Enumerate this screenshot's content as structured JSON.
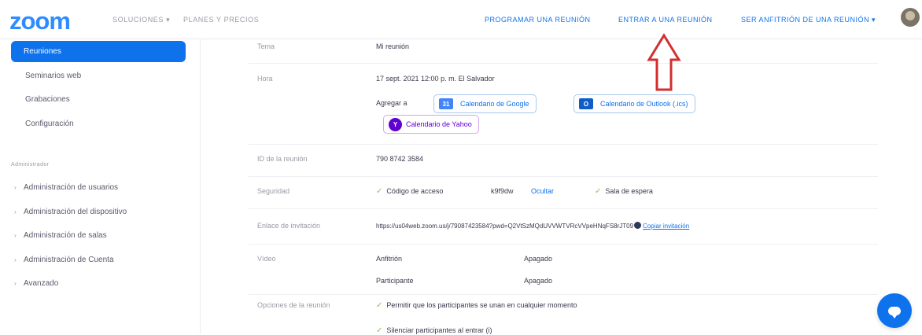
{
  "brand": {
    "logo_text": "zoom",
    "color": "#2d8cff",
    "accent": "#0e72ed"
  },
  "topnav": {
    "left": [
      {
        "label": "SOLUCIONES ▾"
      },
      {
        "label": "PLANES Y PRECIOS"
      }
    ],
    "right": [
      {
        "label": "PROGRAMAR UNA REUNIÓN"
      },
      {
        "label": "ENTRAR A UNA REUNIÓN"
      },
      {
        "label": "SER ANFITRIÓN DE UNA REUNIÓN ▾"
      }
    ],
    "avatar_icon": "user-avatar"
  },
  "sidebar": {
    "active_item": "Reuniones",
    "items": [
      "Seminarios web",
      "Grabaciones",
      "Configuración"
    ],
    "section_title": "Administrador",
    "admin_items": [
      "Administración de usuarios",
      "Administración del dispositivo",
      "Administración de salas",
      "Administración de Cuenta",
      "Avanzado"
    ]
  },
  "meeting": {
    "rows": {
      "topic": {
        "label": "Tema",
        "value": "Mi reunión"
      },
      "time": {
        "label": "Hora",
        "value": "17 sept. 2021 12:00 p. m. El Salvador"
      },
      "meeting_id": {
        "label": "ID de la reunión",
        "value": "790 8742 3584"
      },
      "security": {
        "label": "Seguridad",
        "passcode_label": "Código de acceso",
        "passcode_value": "k9f9dw",
        "show_link": "Ocultar",
        "waiting_room": "Sala de espera"
      },
      "invite_link": {
        "label": "Enlace de invitación",
        "url": "https://us04web.zoom.us/j/79087423584?pwd=Q2VtSzMQdUVVWTVRcVVpeHNqFS8rJT09",
        "copy_label": "Copiar invitación"
      },
      "video": {
        "label": "Vídeo",
        "host_label": "Anfitrión",
        "host_value": "Apagado",
        "participant_label": "Participante",
        "participant_value": "Apagado"
      },
      "options": {
        "label": "Opciones de la reunión",
        "items": [
          "Permitir que los participantes se unan en cualquier momento",
          "Silenciar participantes al entrar (i)"
        ]
      }
    },
    "add_to_calendar": {
      "label": "Agregar a",
      "google": "Calendario de Google",
      "outlook": "Calendario de Outlook (.ics)",
      "yahoo": "Calendario de Yahoo"
    }
  },
  "colors": {
    "primary_blue": "#0e72ed",
    "arrow_red": "#d32f2f",
    "check_green": "#8cc152",
    "yahoo_purple": "#6001d2",
    "outlook_blue": "#0f5ec7",
    "google_blue": "#4285f4"
  }
}
